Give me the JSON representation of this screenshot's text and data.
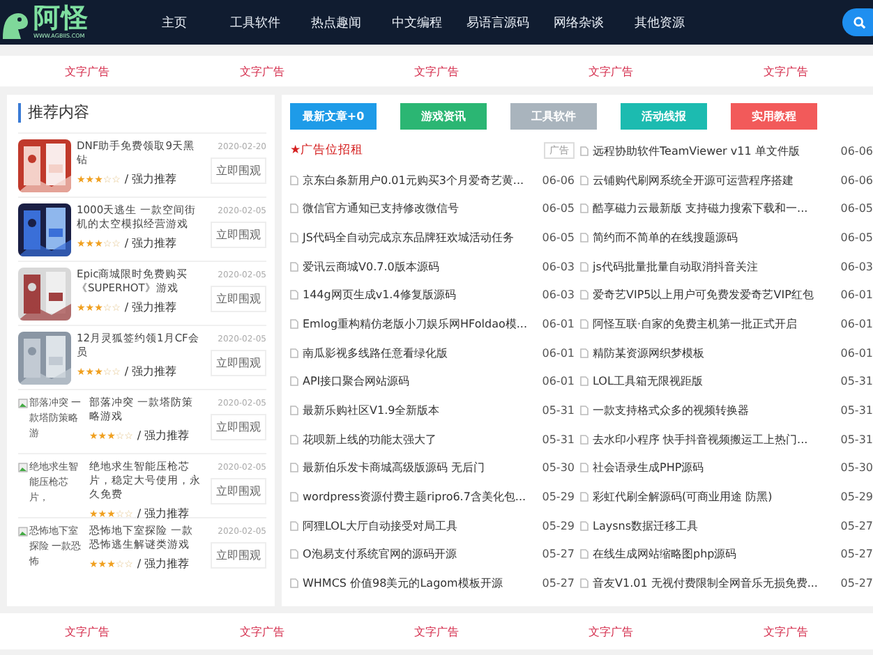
{
  "header": {
    "logo": {
      "title": "阿怪",
      "subtitle": "WWW.AGBIIS.COM"
    },
    "nav": [
      "主页",
      "工具软件",
      "热点趣闻",
      "中文编程",
      "易语言源码",
      "网络杂谈",
      "其他资源"
    ]
  },
  "top_ads": [
    "文字广告",
    "文字广告",
    "文字广告",
    "文字广告",
    "文字广告"
  ],
  "sidebar": {
    "title": "推荐内容",
    "items": [
      {
        "title": "DNF助手免费领取9天黑钻",
        "stars": 3,
        "tag": "/ 强力推荐",
        "date": "2020-02-20",
        "button": "立即围观"
      },
      {
        "title": "1000天逃生 一款空间街机的太空模拟经营游戏",
        "stars": 3,
        "tag": "/ 强力推荐",
        "date": "2020-02-05",
        "button": "立即围观"
      },
      {
        "title": "Epic商城限时免费购买《SUPERHOT》游戏",
        "stars": 3,
        "tag": "/ 强力推荐",
        "date": "2020-02-05",
        "button": "立即围观"
      },
      {
        "title": "12月灵狐签约领1月CF会员",
        "stars": 3,
        "tag": "/ 强力推荐",
        "date": "2020-02-05",
        "button": "立即围观"
      },
      {
        "title": "部落冲突 一款塔防策略游戏",
        "stars": 3,
        "tag": "/ 强力推荐",
        "date": "2020-02-05",
        "button": "立即围观",
        "thumb": {
          "kind": "broken",
          "alt": "部落冲突 一款塔防策略游"
        }
      },
      {
        "title": "绝地求生智能压枪芯片，稳定大号使用，永久免费",
        "stars": 3,
        "tag": "/ 强力推荐",
        "date": "2020-02-05",
        "button": "立即围观",
        "thumb": {
          "kind": "broken",
          "alt": "绝地求生智能压枪芯片，"
        }
      },
      {
        "title": "恐怖地下室探险 一款恐怖逃生解谜类游戏",
        "stars": 3,
        "tag": "/ 强力推荐",
        "date": "2020-02-05",
        "button": "立即围观",
        "thumb": {
          "kind": "broken",
          "alt": "恐怖地下室探险 一款恐怖"
        }
      }
    ]
  },
  "articles": {
    "tabs": [
      {
        "label": "最新文章+0",
        "color": "#1e9be8"
      },
      {
        "label": "游戏资讯",
        "color": "#2bb673"
      },
      {
        "label": "工具软件",
        "color": "#a9b4bd"
      },
      {
        "label": "活动线报",
        "color": "#1cbbb0"
      },
      {
        "label": "实用教程",
        "color": "#f25a5a"
      }
    ],
    "pinned": {
      "title": "★广告位招租",
      "tag": "广告"
    },
    "columns": [
      [
        {
          "title": "京东白条新用户0.01元购买3个月爱奇艺黄...",
          "date": "06-06"
        },
        {
          "title": "微信官方通知已支持修改微信号",
          "date": "06-05"
        },
        {
          "title": "JS代码全自动完成京东品牌狂欢城活动任务",
          "date": "06-05"
        },
        {
          "title": "爱讯云商城V0.7.0版本源码",
          "date": "06-03"
        },
        {
          "title": "144g网页生成v1.4修复版源码",
          "date": "06-03"
        },
        {
          "title": "Emlog重构精仿老版小刀娱乐网HFoldao模...",
          "date": "06-01"
        },
        {
          "title": "南瓜影视多线路任意看绿化版",
          "date": "06-01"
        },
        {
          "title": "API接口聚合网站源码",
          "date": "06-01"
        },
        {
          "title": "最新乐购社区V1.9全新版本",
          "date": "05-31"
        },
        {
          "title": "花呗新上线的功能太强大了",
          "date": "05-31"
        },
        {
          "title": "最新伯乐发卡商城高级版源码 无后门",
          "date": "05-30"
        },
        {
          "title": "wordpress资源付费主题ripro6.7含美化包...",
          "date": "05-29"
        },
        {
          "title": "阿狸LOL大厅自动接受对局工具",
          "date": "05-29"
        },
        {
          "title": "O泡易支付系统官网的源码开源",
          "date": "05-27"
        },
        {
          "title": "WHMCS 价值98美元的Lagom模板开源",
          "date": "05-27"
        }
      ],
      [
        {
          "title": "远程协助软件TeamViewer v11 单文件版",
          "date": "06-06"
        },
        {
          "title": "云铺购代刷网系统全开源可运营程序搭建",
          "date": "06-06"
        },
        {
          "title": "酷享磁力云最新版 支持磁力搜索下载和一...",
          "date": "06-05"
        },
        {
          "title": "简约而不简单的在线搜题源码",
          "date": "06-05"
        },
        {
          "title": "js代码批量批量自动取消抖音关注",
          "date": "06-03"
        },
        {
          "title": "爱奇艺VIP5以上用户可免费发爱奇艺VIP红包",
          "date": "06-01"
        },
        {
          "title": "阿怪互联·自家的免费主机第一批正式开启",
          "date": "06-01"
        },
        {
          "title": "精防某资源网织梦模板",
          "date": "06-01"
        },
        {
          "title": "LOL工具箱无限视距版",
          "date": "05-31"
        },
        {
          "title": "一款支持格式众多的视频转换器",
          "date": "05-31"
        },
        {
          "title": "去水印小程序 快手抖音视频搬运工上热门...",
          "date": "05-31"
        },
        {
          "title": "社会语录生成PHP源码",
          "date": "05-30"
        },
        {
          "title": "彩虹代刷全解源码(可商业用途 防黑)",
          "date": "05-29"
        },
        {
          "title": "Laysns数据迁移工具",
          "date": "05-27"
        },
        {
          "title": "在线生成网站缩略图php源码",
          "date": "05-27"
        },
        {
          "title": "音友V1.01 无视付费限制全网音乐无损免费...",
          "date": "05-27"
        }
      ]
    ]
  },
  "bottom_ads": [
    "文字广告",
    "文字广告",
    "文字广告",
    "文字广告",
    "文字广告"
  ]
}
